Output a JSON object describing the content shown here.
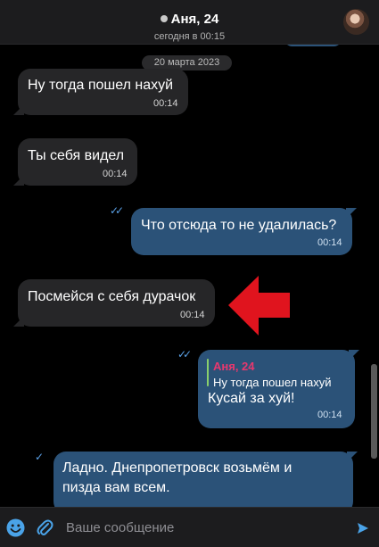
{
  "header": {
    "title": "Аня, 24",
    "subtitle": "сегодня в 00:15"
  },
  "chat": {
    "date_label": "20 марта 2023",
    "messages": [
      {
        "direction": "in",
        "text": "Ну тогда пошел нахуй",
        "time": "00:14"
      },
      {
        "direction": "in",
        "text": "Ты себя видел",
        "time": "00:14"
      },
      {
        "direction": "out",
        "text": "Что отсюда то не удалилась?",
        "time": "00:14",
        "status": "read"
      },
      {
        "direction": "in",
        "text": "Посмейся с себя дурачок",
        "time": "00:14"
      },
      {
        "direction": "out",
        "text": "Кусай за хуй!",
        "time": "00:14",
        "status": "read",
        "reply": {
          "name": "Аня, 24",
          "text": "Ну тогда пошел нахуй"
        }
      },
      {
        "direction": "out",
        "text_line1": "Ладно. Днепропетровск возьмём и",
        "text_line2": "пизда вам всем.",
        "status": "sent"
      }
    ]
  },
  "composer": {
    "placeholder": "Ваше сообщение"
  },
  "colors": {
    "incoming_bubble": "#262628",
    "outgoing_bubble": "#2b5278",
    "reply_name": "#e8386e",
    "accent": "#5aa0e6",
    "annotation_arrow": "#e0141e"
  },
  "icons": [
    "emoji-icon",
    "attach-icon",
    "send-icon",
    "read-check-icon",
    "sent-check-icon",
    "annotation-arrow"
  ]
}
